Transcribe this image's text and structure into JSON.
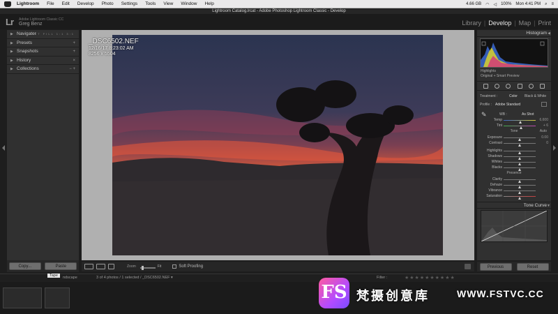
{
  "menubar": {
    "app_name": "Lightroom",
    "items": [
      "File",
      "Edit",
      "Develop",
      "Photo",
      "Settings",
      "Tools",
      "View",
      "Window",
      "Help"
    ],
    "battery": "100%",
    "clock": "Mon 4:41 PM",
    "disk": "4.66 GB"
  },
  "window_title": "Lightroom Catalog.lrcat - Adobe Photoshop Lightroom Classic - Develop",
  "identity": {
    "logo": "Lr",
    "catalog": "Adobe Lightroom Classic CC",
    "user": "Greg Benz"
  },
  "modules": {
    "library": "Library",
    "develop": "Develop",
    "map": "Map",
    "print": "Print"
  },
  "left_panel": {
    "navigator": "Navigator",
    "fit_labels": "FIT FILL 1:1 3:1",
    "presets": "Presets",
    "snapshots": "Snapshots",
    "history": "History",
    "collections": "Collections",
    "plus": "+",
    "minus_plus": "− +",
    "history_x": "×",
    "copy": "Copy...",
    "paste": "Paste"
  },
  "photo": {
    "filename": "_DSC6502.NEF",
    "datetime": "12/16/17 8:23:02 AM",
    "dimensions": "8256 x 5504"
  },
  "toolbar": {
    "zoom_label": "Zoom",
    "fit_label": "Fit",
    "soft_proofing": "Soft Proofing"
  },
  "right_panel": {
    "histogram": "Histogram",
    "highlights": "Highlights",
    "original_preview": "Original + Smart Preview",
    "treatment_label": "Treatment :",
    "treatment_color": "Color",
    "treatment_bw": "Black & White",
    "profile_label": "Profile :",
    "profile_value": "Adobe Standard",
    "wb_label": "WB :",
    "wb_value": "As Shot",
    "temp_label": "Temp",
    "temp_value": "6,600",
    "tint_label": "Tint",
    "tint_value": "+ 6",
    "tone_label": "Tone",
    "auto_label": "Auto",
    "exposure_label": "Exposure",
    "exposure_value": "0.00",
    "contrast_label": "Contrast",
    "contrast_value": "0",
    "highlights_label": "Highlights",
    "shadows_label": "Shadows",
    "whites_label": "Whites",
    "blacks_label": "Blacks",
    "presence_label": "Presence",
    "clarity_label": "Clarity",
    "dehaze_label": "Dehaze",
    "vibrance_label": "Vibrance",
    "saturation_label": "Saturation",
    "tone_curve": "Tone Curve",
    "previous": "Previous",
    "reset": "Reset"
  },
  "filmstrip": {
    "tape": "Tape",
    "breadcrumb": "3 of 4 photos / 1 selected / _DSC6502.NEF ▾",
    "landscape": "ndscape",
    "filter": "Filter :"
  },
  "watermark": {
    "logo_text": "FS",
    "chinese": "梵摄创意库",
    "url": "WWW.FSTVC.CC"
  }
}
